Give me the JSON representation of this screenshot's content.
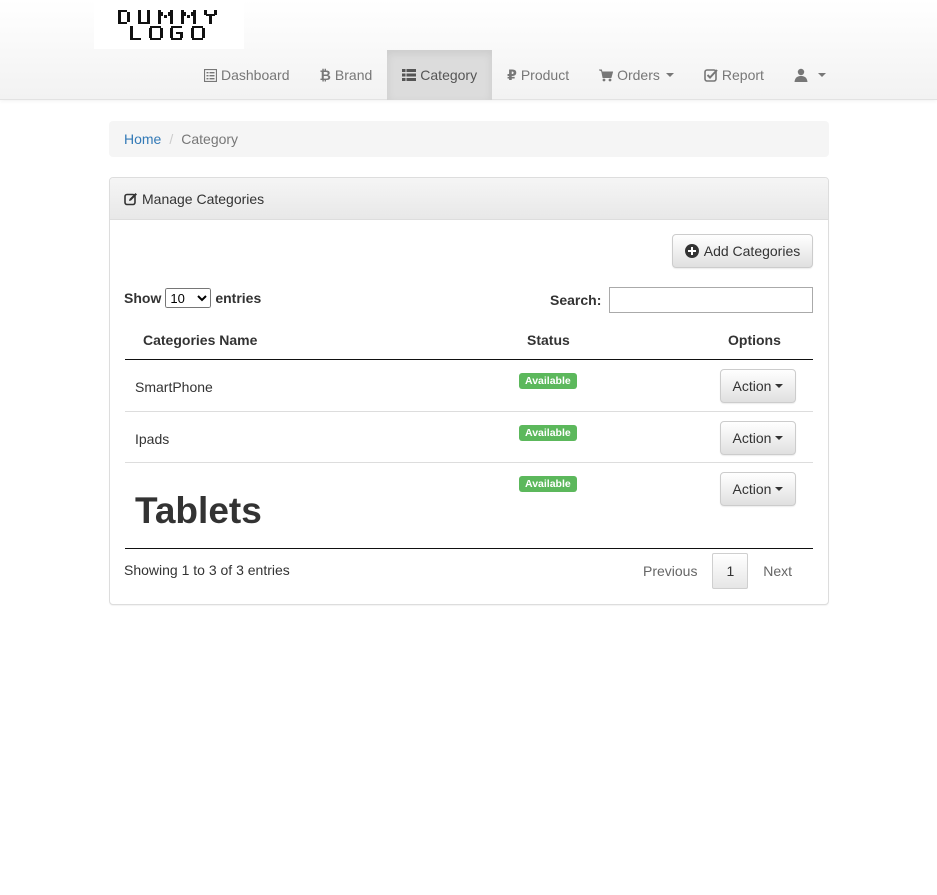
{
  "brand": {
    "logo_text": "DUMMY LOGO"
  },
  "nav": {
    "items": [
      {
        "label": "Dashboard",
        "icon": "list-alt-icon"
      },
      {
        "label": "Brand",
        "icon": "bitcoin-icon"
      },
      {
        "label": "Category",
        "icon": "th-list-icon",
        "active": true
      },
      {
        "label": "Product",
        "icon": "ruble-icon"
      },
      {
        "label": "Orders",
        "icon": "cart-icon",
        "dropdown": true
      },
      {
        "label": "Report",
        "icon": "check-square-icon"
      }
    ],
    "user_icon": "user-icon"
  },
  "breadcrumb": {
    "home": "Home",
    "current": "Category"
  },
  "panel": {
    "title": "Manage Categories",
    "add_button": "Add Categories"
  },
  "datatable": {
    "show_label": "Show",
    "entries_label": "entries",
    "length_selected": "10",
    "search_label": "Search:",
    "search_value": "",
    "columns": [
      "Categories Name",
      "Status",
      "Options"
    ],
    "rows": [
      {
        "name": "SmartPhone",
        "status": "Available",
        "action": "Action"
      },
      {
        "name": "Ipads",
        "status": "Available",
        "action": "Action"
      },
      {
        "name": "Tablets",
        "status": "Available",
        "action": "Action"
      }
    ],
    "info": "Showing 1 to 3 of 3 entries",
    "pagination": {
      "previous": "Previous",
      "current_page": "1",
      "next": "Next"
    }
  },
  "colors": {
    "status_available": "#5cb85c",
    "link": "#337ab7",
    "active_nav_bg": "#dcdcdc"
  }
}
